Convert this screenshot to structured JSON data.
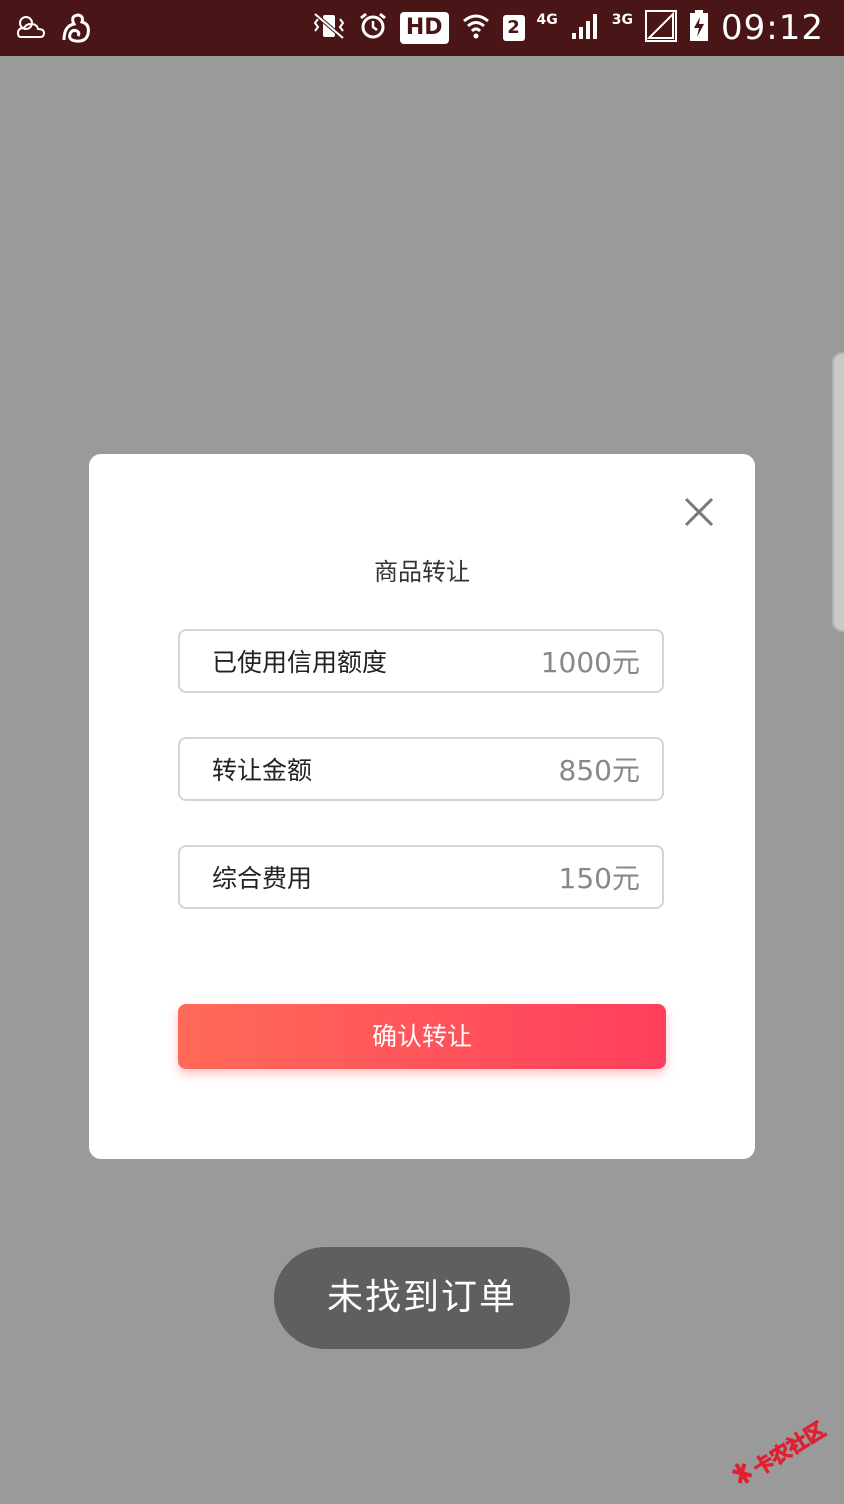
{
  "status_bar": {
    "hd_badge": "HD",
    "sim_slot": "2",
    "network_1": "4G",
    "network_2": "3G",
    "time": "09:12",
    "icons": [
      "cloud-icon",
      "uc-browser-icon",
      "vibrate-icon",
      "alarm-icon",
      "wifi-icon",
      "signal-4g-icon",
      "signal-3g-icon",
      "battery-icon"
    ],
    "background_color": "#4a1517"
  },
  "dialog": {
    "title": "商品转让",
    "fields": [
      {
        "label": "已使用信用额度",
        "value": "1000元"
      },
      {
        "label": "转让金额",
        "value": "850元"
      },
      {
        "label": "综合费用",
        "value": "150元"
      }
    ],
    "confirm_label": "确认转让",
    "accent_colors": [
      "#ff6a58",
      "#ff3f5d"
    ]
  },
  "toast": {
    "message": "未找到订单"
  },
  "watermark": {
    "text": "卡农社区",
    "color": "#e02030"
  }
}
